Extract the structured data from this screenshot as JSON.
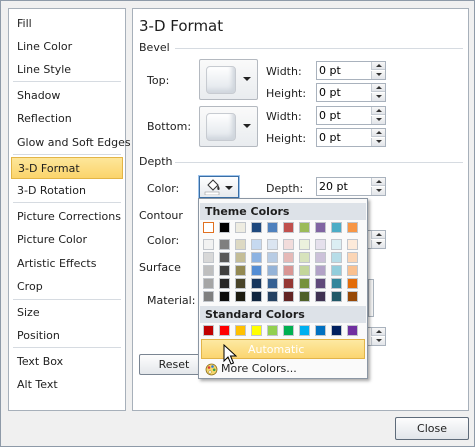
{
  "sidebar": {
    "items": [
      {
        "label": "Fill"
      },
      {
        "label": "Line Color"
      },
      {
        "label": "Line Style"
      },
      {
        "label": "Shadow"
      },
      {
        "label": "Reflection"
      },
      {
        "label": "Glow and Soft Edges"
      },
      {
        "label": "3-D Format",
        "selected": true
      },
      {
        "label": "3-D Rotation"
      },
      {
        "label": "Picture Corrections"
      },
      {
        "label": "Picture Color"
      },
      {
        "label": "Artistic Effects"
      },
      {
        "label": "Crop"
      },
      {
        "label": "Size"
      },
      {
        "label": "Position"
      },
      {
        "label": "Text Box"
      },
      {
        "label": "Alt Text"
      }
    ]
  },
  "main": {
    "title": "3-D Format",
    "bevel": {
      "section": "Bevel",
      "top_label": "Top:",
      "bottom_label": "Bottom:",
      "width_label": "Width:",
      "height_label": "Height:",
      "top_width": "0 pt",
      "top_height": "0 pt",
      "bottom_width": "0 pt",
      "bottom_height": "0 pt"
    },
    "depth": {
      "section": "Depth",
      "color_label": "Color:",
      "depth_label": "Depth:",
      "depth_value": "20 pt"
    },
    "contour": {
      "section": "Contour",
      "color_label": "Color:"
    },
    "surface": {
      "section": "Surface",
      "material_label": "Material:"
    },
    "reset_label": "Reset"
  },
  "popup": {
    "theme_header": "Theme Colors",
    "standard_header": "Standard Colors",
    "automatic_label": "Automatic",
    "more_colors_label": "More Colors...",
    "theme_top": [
      "#ffffff",
      "#000000",
      "#eeece1",
      "#1f497d",
      "#4f81bd",
      "#c0504d",
      "#9bbb59",
      "#8064a2",
      "#4bacc6",
      "#f79646"
    ],
    "theme_shades": [
      [
        "#f2f2f2",
        "#7f7f7f",
        "#ddd9c3",
        "#c6d9f0",
        "#dbe5f1",
        "#f2dcdb",
        "#ebf1dd",
        "#e5e0ec",
        "#dbeef3",
        "#fdeada"
      ],
      [
        "#d8d8d8",
        "#595959",
        "#c4bd97",
        "#8db3e2",
        "#b8cce4",
        "#e5b9b7",
        "#d7e3bc",
        "#ccc1d9",
        "#b7dde8",
        "#fbd5b5"
      ],
      [
        "#bfbfbf",
        "#3f3f3f",
        "#938953",
        "#548dd4",
        "#95b3d7",
        "#d99694",
        "#c3d69b",
        "#b2a2c7",
        "#92cddc",
        "#fac08f"
      ],
      [
        "#a5a5a5",
        "#262626",
        "#494429",
        "#17365d",
        "#366092",
        "#953734",
        "#76923c",
        "#5f497a",
        "#31859b",
        "#e36c09"
      ],
      [
        "#7f7f7f",
        "#0c0c0c",
        "#1d1b10",
        "#0f243e",
        "#244061",
        "#632423",
        "#4f6128",
        "#3f3151",
        "#205867",
        "#974806"
      ]
    ],
    "standard": [
      "#c00000",
      "#ff0000",
      "#ffc000",
      "#ffff00",
      "#92d050",
      "#00b050",
      "#00b0f0",
      "#0070c0",
      "#002060",
      "#7030a0"
    ]
  },
  "footer": {
    "close_label": "Close"
  }
}
